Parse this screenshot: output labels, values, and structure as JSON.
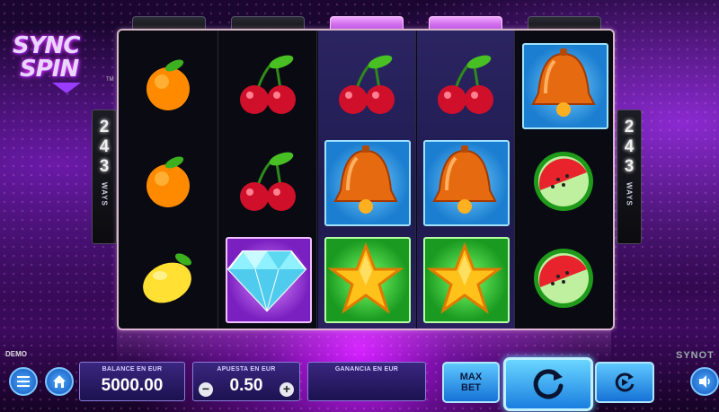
{
  "game": {
    "logo_line1": "SYNC",
    "logo_line2": "SPIN",
    "logo_tm": "TM",
    "ways_count": "243",
    "ways_label": "WAYS",
    "demo_label": "DEMO",
    "provider": "SYNOT"
  },
  "reels": [
    [
      "orange-icon",
      "orange-icon",
      "lemon-icon"
    ],
    [
      "cherry-icon",
      "cherry-icon",
      "diamond-icon"
    ],
    [
      "cherry-icon",
      "bell-icon",
      "star-icon"
    ],
    [
      "cherry-icon",
      "bell-icon",
      "star-icon"
    ],
    [
      "bell-icon",
      "watermelon-icon",
      "watermelon-icon"
    ]
  ],
  "controls": {
    "balance_caption": "BALANCE EN EUR",
    "balance_value": "5000.00",
    "bet_caption": "APUESTA EN EUR",
    "bet_value": "0.50",
    "bet_minus": "−",
    "bet_plus": "+",
    "win_caption": "GANANCIA EN EUR",
    "win_value": "",
    "maxbet_line1": "MAX",
    "maxbet_line2": "BET"
  },
  "colors": {
    "accent": "#d21cff",
    "button_blue": "#1a7ee0"
  }
}
